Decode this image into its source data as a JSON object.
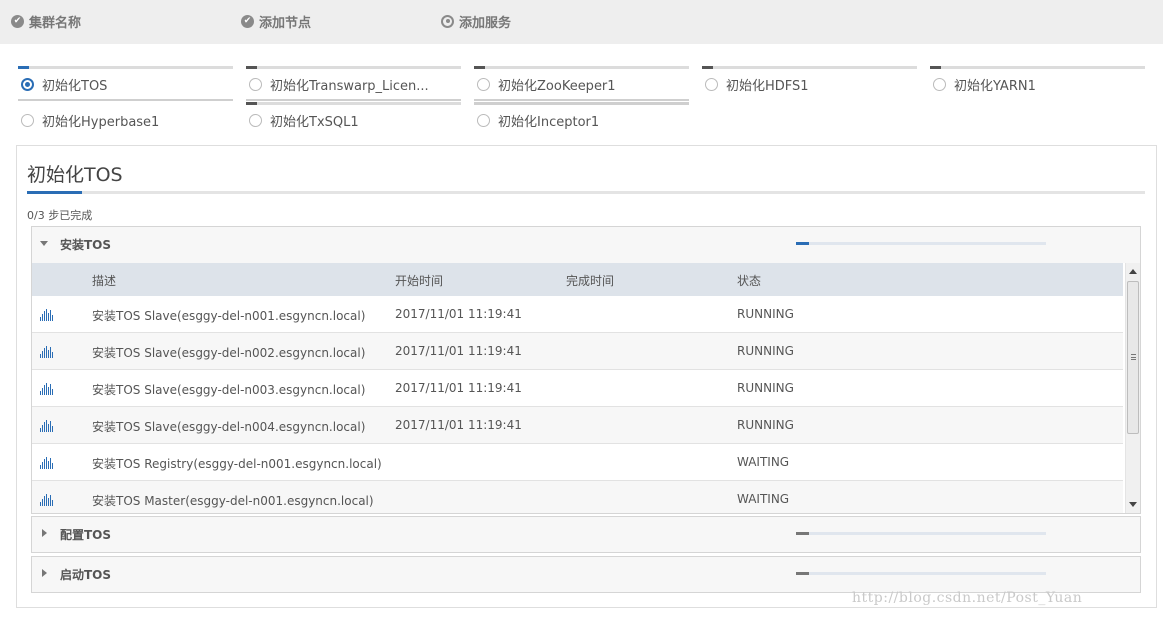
{
  "wizard": {
    "steps": [
      {
        "label": "集群名称",
        "icon": "check-circle-icon"
      },
      {
        "label": "添加节点",
        "icon": "check-circle-icon"
      },
      {
        "label": "添加服务",
        "icon": "target-circle-icon"
      }
    ]
  },
  "services": [
    {
      "label": "初始化TOS",
      "active": true,
      "progress": 0.05
    },
    {
      "label": "初始化Transwarp_Licen...",
      "active": false,
      "progress": 0.05
    },
    {
      "label": "初始化ZooKeeper1",
      "active": false,
      "progress": 0.05
    },
    {
      "label": "初始化HDFS1",
      "active": false,
      "progress": 0.05
    },
    {
      "label": "初始化YARN1",
      "active": false,
      "progress": 0.05
    },
    {
      "label": "初始化Hyperbase1",
      "active": false,
      "progress": 0
    },
    {
      "label": "初始化TxSQL1",
      "active": false,
      "progress": 0.05
    },
    {
      "label": "初始化Inceptor1",
      "active": false,
      "progress": 0
    }
  ],
  "panel": {
    "title": "初始化TOS",
    "progress_text": "0/3 步已完成"
  },
  "groups": [
    {
      "name": "安装TOS",
      "expanded": true,
      "progress": 0.05
    },
    {
      "name": "配置TOS",
      "expanded": false,
      "progress": 0.05
    },
    {
      "name": "启动TOS",
      "expanded": false,
      "progress": 0.05
    }
  ],
  "table": {
    "columns": [
      "描述",
      "开始时间",
      "完成时间",
      "状态"
    ],
    "rows": [
      {
        "desc": "安装TOS Slave(esggy-del-n001.esgyncn.local)",
        "start": "2017/11/01 11:19:41",
        "end": "",
        "status": "RUNNING"
      },
      {
        "desc": "安装TOS Slave(esggy-del-n002.esgyncn.local)",
        "start": "2017/11/01 11:19:41",
        "end": "",
        "status": "RUNNING"
      },
      {
        "desc": "安装TOS Slave(esggy-del-n003.esgyncn.local)",
        "start": "2017/11/01 11:19:41",
        "end": "",
        "status": "RUNNING"
      },
      {
        "desc": "安装TOS Slave(esggy-del-n004.esgyncn.local)",
        "start": "2017/11/01 11:19:41",
        "end": "",
        "status": "RUNNING"
      },
      {
        "desc": "安装TOS Registry(esggy-del-n001.esgyncn.local)",
        "start": "",
        "end": "",
        "status": "WAITING"
      },
      {
        "desc": "安装TOS Master(esggy-del-n001.esgyncn.local)",
        "start": "",
        "end": "",
        "status": "WAITING"
      }
    ]
  },
  "watermark": "http://blog.csdn.net/Post_Yuan",
  "colors": {
    "accent": "#2a6db5",
    "header_bg": "#dde3ea",
    "wizard_bg": "#eeeeee"
  }
}
